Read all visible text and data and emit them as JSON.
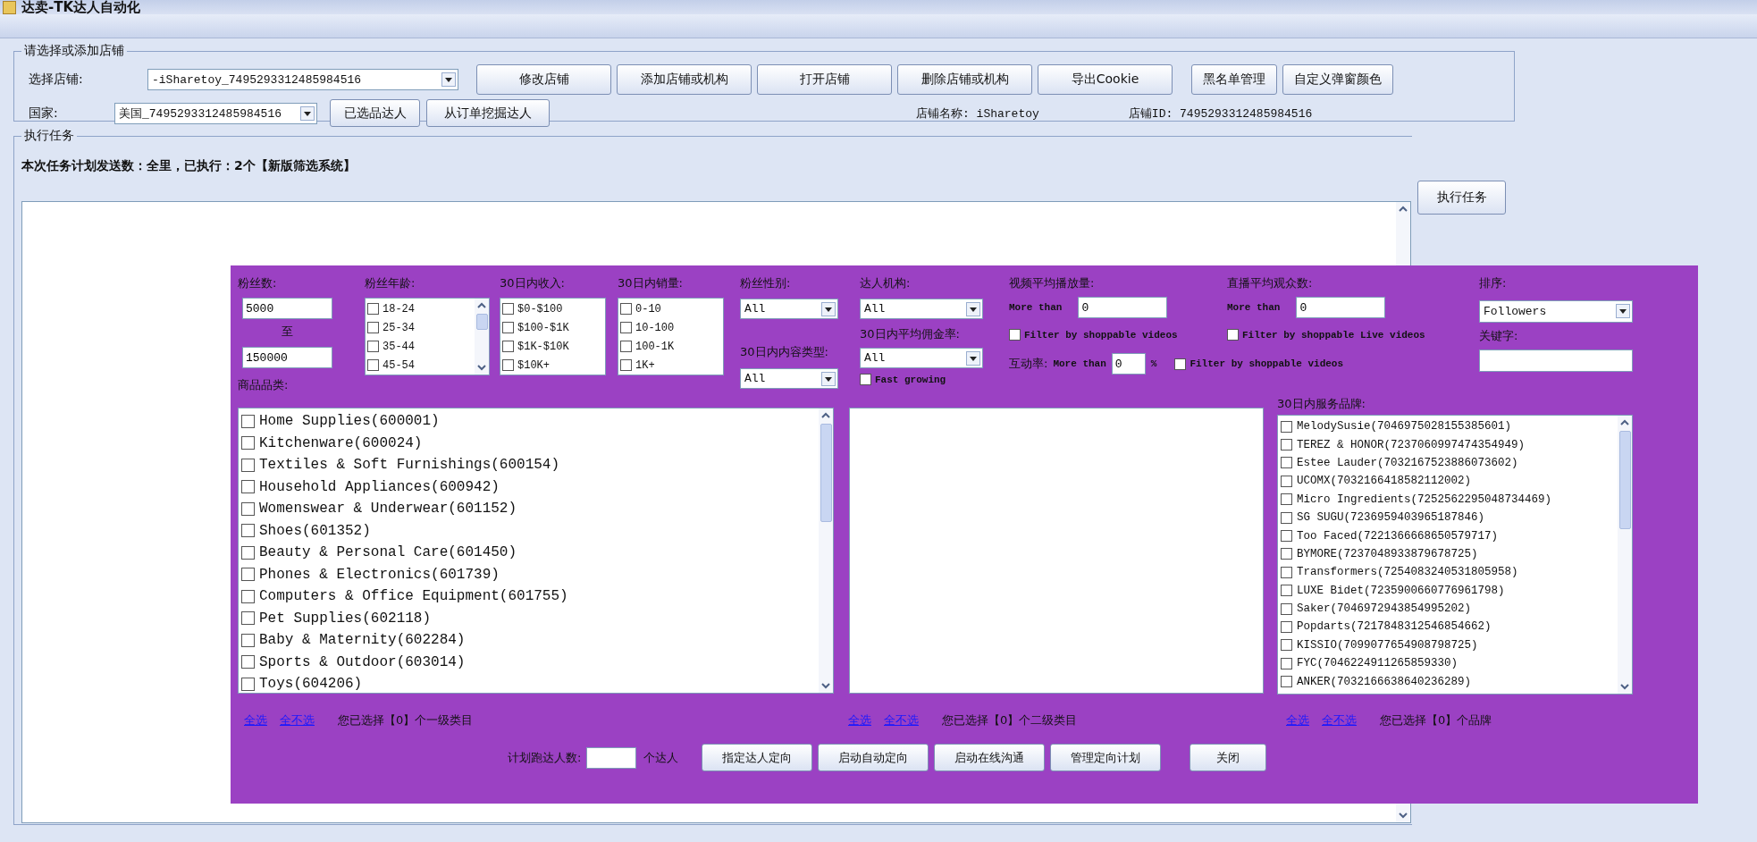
{
  "window": {
    "title": "达卖-TK达人自动化"
  },
  "store_group": {
    "title": "请选择或添加店铺",
    "store_label": "选择店铺:",
    "store_value": "-iSharetoy_7495293312485984516",
    "buttons": [
      "修改店铺",
      "添加店铺或机构",
      "打开店铺",
      "删除店铺或机构",
      "导出Cookie",
      "黑名单管理",
      "自定义弹窗颜色"
    ],
    "country_label": "国家:",
    "country_value": "美国_7495293312485984516",
    "country_buttons": [
      "已选品达人",
      "从订单挖掘达人"
    ],
    "store_name": "店铺名称: iSharetoy",
    "store_id": "店铺ID: 7495293312485984516"
  },
  "task_group": {
    "title": "执行任务",
    "summary": "本次任务计划发送数：全里，已执行：2个【新版筛选系统】",
    "run_button": "执行任务"
  },
  "filter_panel": {
    "followers": {
      "label": "粉丝数:",
      "min": "5000",
      "separator": "至",
      "max": "150000"
    },
    "age": {
      "label": "粉丝年龄:",
      "options": [
        {
          "label": "18-24",
          "checked": false
        },
        {
          "label": "25-34",
          "checked": false
        },
        {
          "label": "35-44",
          "checked": false
        },
        {
          "label": "45-54",
          "checked": false
        }
      ]
    },
    "income": {
      "label": "30日内收入:",
      "options": [
        {
          "label": "$0-$100",
          "checked": false
        },
        {
          "label": "$100-$1K",
          "checked": false
        },
        {
          "label": "$1K-$10K",
          "checked": false
        },
        {
          "label": "$10K+",
          "checked": false
        }
      ]
    },
    "sales": {
      "label": "30日内销量:",
      "options": [
        {
          "label": "0-10",
          "checked": false
        },
        {
          "label": "10-100",
          "checked": false
        },
        {
          "label": "100-1K",
          "checked": false
        },
        {
          "label": "1K+",
          "checked": false
        }
      ]
    },
    "gender": {
      "label": "粉丝性别:",
      "value": "All"
    },
    "content_type": {
      "label": "30日内内容类型:",
      "value": "All"
    },
    "agency": {
      "label": "达人机构:",
      "value": "All"
    },
    "commission": {
      "label": "30日内平均佣金率:",
      "value": "All"
    },
    "fast_growing": {
      "label": "Fast growing",
      "checked": false
    },
    "video_views": {
      "label": "视频平均播放量:",
      "prefix": "More than",
      "value": "0",
      "filter": {
        "label": "Filter by shoppable videos",
        "checked": false
      }
    },
    "live_viewers": {
      "label": "直播平均观众数:",
      "prefix": "More than",
      "value": "0",
      "filter": {
        "label": "Filter by shoppable Live videos",
        "checked": false
      }
    },
    "engagement": {
      "label": "互动率:",
      "prefix": "More than",
      "value": "0",
      "unit": "%",
      "filter": {
        "label": "Filter by shoppable videos",
        "checked": false
      }
    },
    "sort": {
      "label": "排序:",
      "value": "Followers"
    },
    "keyword": {
      "label": "关键字:"
    },
    "categories": {
      "label": "商品品类:",
      "items": [
        {
          "label": "Home Supplies(600001)",
          "checked": false
        },
        {
          "label": "Kitchenware(600024)",
          "checked": false
        },
        {
          "label": "Textiles & Soft Furnishings(600154)",
          "checked": false
        },
        {
          "label": "Household Appliances(600942)",
          "checked": false
        },
        {
          "label": "Womenswear & Underwear(601152)",
          "checked": false
        },
        {
          "label": "Shoes(601352)",
          "checked": false
        },
        {
          "label": "Beauty & Personal Care(601450)",
          "checked": false
        },
        {
          "label": "Phones & Electronics(601739)",
          "checked": false
        },
        {
          "label": "Computers & Office Equipment(601755)",
          "checked": false
        },
        {
          "label": "Pet Supplies(602118)",
          "checked": false
        },
        {
          "label": "Baby & Maternity(602284)",
          "checked": false
        },
        {
          "label": "Sports & Outdoor(603014)",
          "checked": false
        },
        {
          "label": "Toys(604206)",
          "checked": false
        }
      ],
      "select_all": "全选",
      "select_none": "全不选",
      "status": "您已选择【0】个一级类目"
    },
    "subcategories": {
      "select_all": "全选",
      "select_none": "全不选",
      "status": "您已选择【0】个二级类目"
    },
    "brands": {
      "label": "30日内服务品牌:",
      "items": [
        {
          "label": "MelodySusie(7046975028155385601)",
          "checked": false
        },
        {
          "label": "TEREZ & HONOR(7237060997474354949)",
          "checked": false
        },
        {
          "label": "Estee Lauder(7032167523886073602)",
          "checked": false
        },
        {
          "label": "UCOMX(7032166418582112002)",
          "checked": false
        },
        {
          "label": "Micro Ingredients(7252562295048734469)",
          "checked": false
        },
        {
          "label": "SG SUGU(7236959403965187846)",
          "checked": false
        },
        {
          "label": "Too Faced(7221366668650579717)",
          "checked": false
        },
        {
          "label": "BYMORE(7237048933879678725)",
          "checked": false
        },
        {
          "label": "Transformers(7254083240531805958)",
          "checked": false
        },
        {
          "label": "LUXE Bidet(7235900660776961798)",
          "checked": false
        },
        {
          "label": "Saker(7046972943854995202)",
          "checked": false
        },
        {
          "label": "Popdarts(7217848312546854662)",
          "checked": false
        },
        {
          "label": "KISSIO(7099077654908798725)",
          "checked": false
        },
        {
          "label": "FYC(7046224911265859330)",
          "checked": false
        },
        {
          "label": "ANKER(7032166638640236289)",
          "checked": false
        }
      ],
      "select_all": "全选",
      "select_none": "全不选",
      "status": "您已选择【0】个品牌"
    },
    "footer": {
      "plan_label": "计划跑达人数:",
      "unit": "个达人",
      "buttons": [
        "指定达人定向",
        "启动自动定向",
        "启动在线沟通",
        "管理定向计划"
      ],
      "close": "关闭"
    }
  }
}
